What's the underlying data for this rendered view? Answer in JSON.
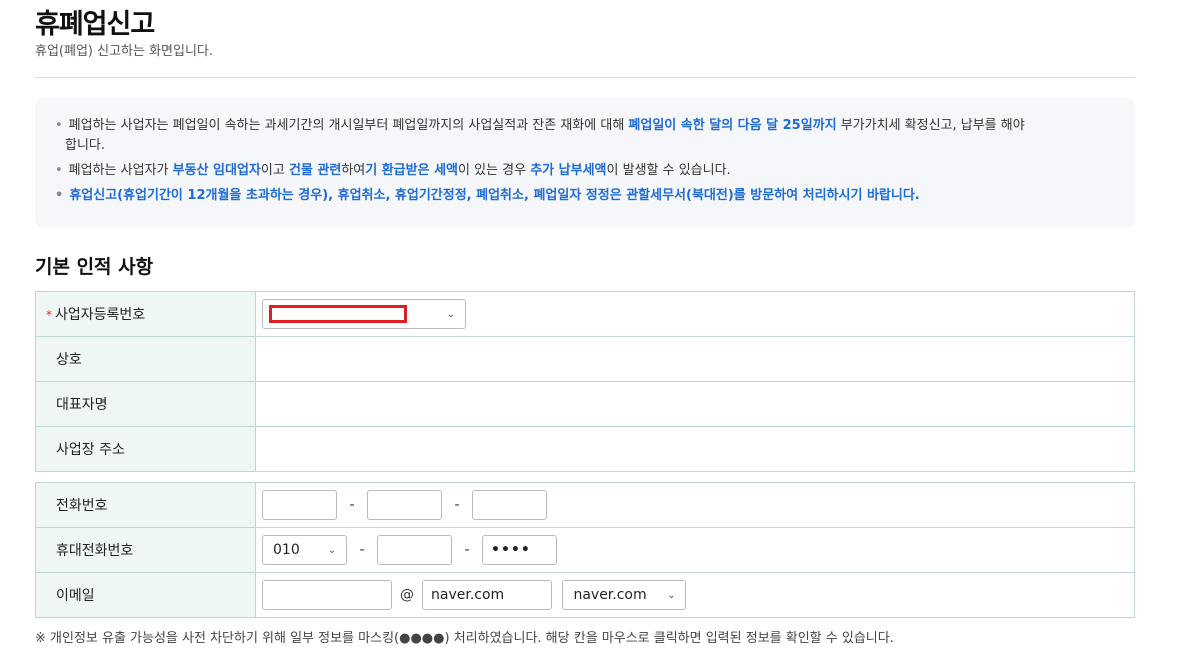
{
  "header": {
    "title": "휴폐업신고",
    "subtitle": "휴업(폐업) 신고하는 화면입니다."
  },
  "notice": {
    "bullet": "•",
    "line1_part1": "폐업하는 사업자는 폐업일이 속하는 과세기간의 개시일부터 폐업일까지의 사업실적과 잔존 재화에 대해 ",
    "line1_highlight": "폐업일이 속한 달의 다음 달 25일까지",
    "line1_part2": " 부가가치세 확정신고, 납부를 해야",
    "line1_cont": "합니다.",
    "line2_part1": "폐업하는 사업자가 ",
    "line2_hl1": "부동산 임대업자",
    "line2_part2": "이고 ",
    "line2_hl2": "건물 관련",
    "line2_part3": "하여",
    "line2_hl3": "기 환급받은 세액",
    "line2_part4": "이 있는 경우 ",
    "line2_hl4": "추가 납부세액",
    "line2_part5": "이 발생할 수 있습니다.",
    "line3": "휴업신고(휴업기간이 12개월을 초과하는 경우), 휴업취소, 휴업기간정정, 폐업취소, 폐업일자 정정은 관할세무서(북대전)를 방문하여 처리하시기 바랍니다."
  },
  "basic_info": {
    "section_title": "기본 인적 사항",
    "required_mark": "*",
    "rows": [
      {
        "label": "사업자등록번호"
      },
      {
        "label": "상호"
      },
      {
        "label": "대표자명"
      },
      {
        "label": "사업장 주소"
      }
    ]
  },
  "contact": {
    "phone_label": "전화번호",
    "mobile_label": "휴대전화번호",
    "email_label": "이메일",
    "dash": "-",
    "at": "@",
    "mobile_prefix": "010",
    "mobile_last": "••••",
    "email_domain": "naver.com",
    "email_domain_select": "naver.com"
  },
  "footnote": "※ 개인정보 유출 가능성을 사전 차단하기 위해 일부 정보를 마스킹(●●●●) 처리하였습니다. 해당 칸을 마우스로 클릭하면 입력된 정보를 확인할 수 있습니다.",
  "icons": {
    "chevron": "chevron-down-icon"
  }
}
